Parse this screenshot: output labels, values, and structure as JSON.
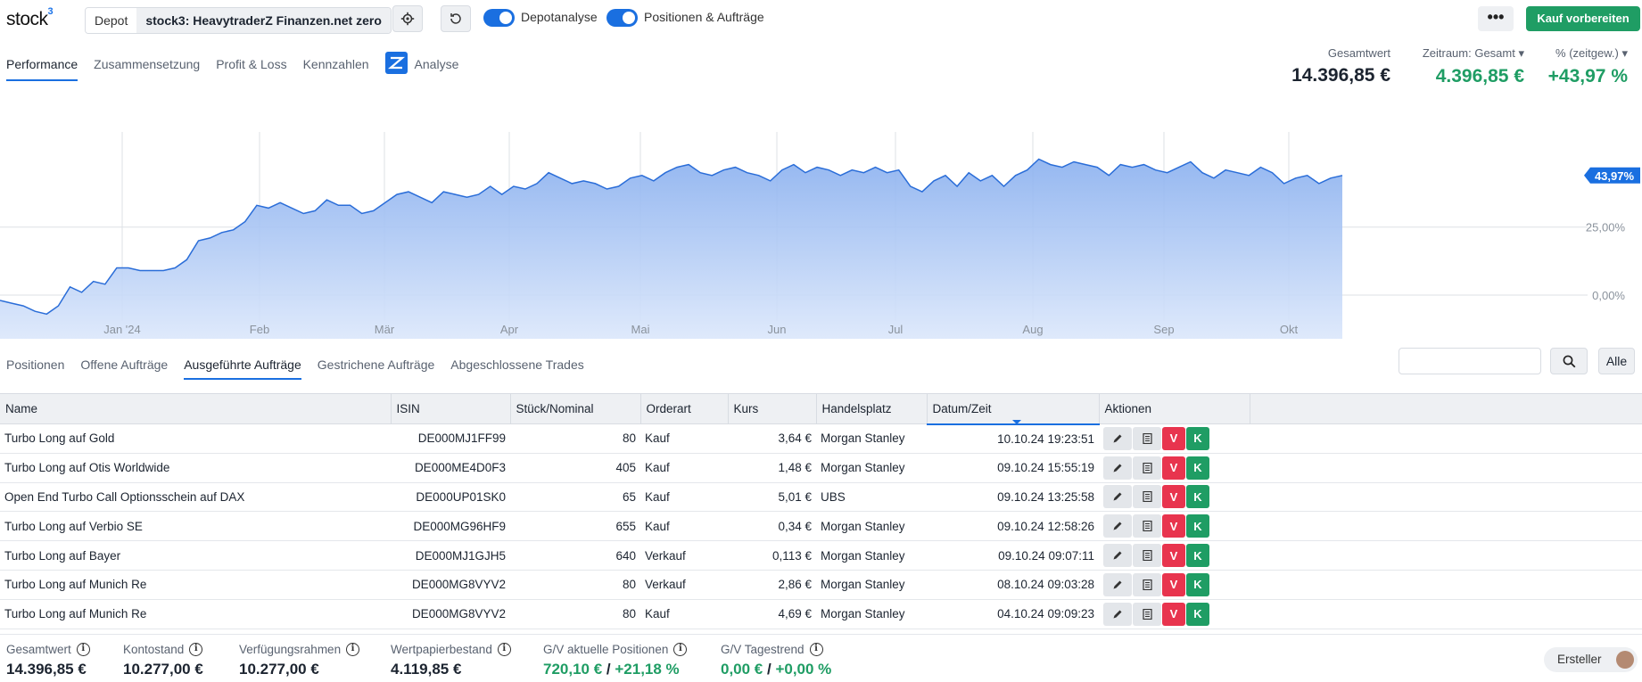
{
  "header": {
    "logo": "stock",
    "logo_sup": "3",
    "depot_label": "Depot",
    "depot_name": "stock3: HeavytraderZ Finanzen.net zero",
    "toggle1_label": "Depotanalyse",
    "toggle2_label": "Positionen & Aufträge",
    "more_label": "•••",
    "buy_label": "Kauf vorbereiten"
  },
  "tabs": [
    "Performance",
    "Zusammensetzung",
    "Profit & Loss",
    "Kennzahlen",
    "Analyse"
  ],
  "summary": {
    "gesamtwert_label": "Gesamtwert",
    "gesamtwert": "14.396,85 €",
    "zeitraum_label": "Zeitraum: Gesamt ▾",
    "zeitraum_value": "4.396,85 €",
    "pct_label": "% (zeitgew.) ▾",
    "pct_value": "+43,97 %"
  },
  "chart_data": {
    "type": "area",
    "x_ticks": [
      "Jan '24",
      "Feb",
      "Mär",
      "Apr",
      "Mai",
      "Jun",
      "Jul",
      "Aug",
      "Sep",
      "Okt"
    ],
    "y_ticks": [
      "0,00%",
      "25,00%"
    ],
    "last_value_label": "43,97%",
    "ylim": [
      -10,
      60
    ],
    "values": [
      -2,
      -3,
      -4,
      -6,
      -7,
      -4,
      3,
      1,
      5,
      4,
      10,
      10,
      9,
      9,
      9,
      10,
      13,
      20,
      21,
      23,
      24,
      27,
      33,
      32,
      34,
      32,
      30,
      31,
      35,
      33,
      33,
      30,
      31,
      34,
      37,
      38,
      36,
      34,
      38,
      37,
      36,
      37,
      40,
      37,
      40,
      39,
      41,
      45,
      43,
      41,
      42,
      41,
      39,
      40,
      43,
      44,
      42,
      45,
      47,
      48,
      45,
      44,
      46,
      47,
      45,
      44,
      42,
      46,
      48,
      45,
      47,
      46,
      44,
      46,
      45,
      47,
      45,
      46,
      40,
      38,
      42,
      44,
      40,
      45,
      42,
      44,
      40,
      44,
      46,
      50,
      48,
      47,
      49,
      48,
      47,
      44,
      48,
      47,
      48,
      46,
      45,
      47,
      49,
      45,
      43,
      46,
      45,
      44,
      47,
      45,
      41,
      43,
      44,
      41,
      43,
      44
    ],
    "grid": true
  },
  "subtabs": [
    "Positionen",
    "Offene Aufträge",
    "Ausgeführte Aufträge",
    "Gestrichene Aufträge",
    "Abgeschlossene Trades"
  ],
  "alle_label": "Alle",
  "table": {
    "headers": [
      "Name",
      "ISIN",
      "Stück/Nominal",
      "Orderart",
      "Kurs",
      "Handelsplatz",
      "Datum/Zeit",
      "Aktionen"
    ],
    "rows": [
      [
        "Turbo Long auf Gold",
        "DE000MJ1FF99",
        "80",
        "Kauf",
        "3,64 €",
        "Morgan Stanley",
        "10.10.24 19:23:51"
      ],
      [
        "Turbo Long auf Otis Worldwide",
        "DE000ME4D0F3",
        "405",
        "Kauf",
        "1,48 €",
        "Morgan Stanley",
        "09.10.24 15:55:19"
      ],
      [
        "Open End Turbo Call Optionsschein auf DAX",
        "DE000UP01SK0",
        "65",
        "Kauf",
        "5,01 €",
        "UBS",
        "09.10.24 13:25:58"
      ],
      [
        "Turbo Long auf Verbio SE",
        "DE000MG96HF9",
        "655",
        "Kauf",
        "0,34 €",
        "Morgan Stanley",
        "09.10.24 12:58:26"
      ],
      [
        "Turbo Long auf Bayer",
        "DE000MJ1GJH5",
        "640",
        "Verkauf",
        "0,113 €",
        "Morgan Stanley",
        "09.10.24 09:07:11"
      ],
      [
        "Turbo Long auf Munich Re",
        "DE000MG8VYV2",
        "80",
        "Verkauf",
        "2,86 €",
        "Morgan Stanley",
        "08.10.24 09:03:28"
      ],
      [
        "Turbo Long auf Munich Re",
        "DE000MG8VYV2",
        "80",
        "Kauf",
        "4,69 €",
        "Morgan Stanley",
        "04.10.24 09:09:23"
      ]
    ],
    "action_v": "V",
    "action_k": "K"
  },
  "footer": {
    "items": [
      {
        "label": "Gesamtwert",
        "value": "14.396,85 €"
      },
      {
        "label": "Kontostand",
        "value": "10.277,00 €"
      },
      {
        "label": "Verfügungsrahmen",
        "value": "10.277,00 €"
      },
      {
        "label": "Wertpapierbestand",
        "value": "4.119,85 €"
      }
    ],
    "gv_label": "G/V aktuelle Positionen",
    "gv_abs": "720,10 €",
    "gv_sep": " / ",
    "gv_pct": "+21,18 %",
    "tag_label": "G/V Tagestrend",
    "tag_abs": "0,00 €",
    "tag_sep": " / ",
    "tag_pct": "+0,00 %",
    "creator_label": "Ersteller",
    "info_glyph": "i"
  }
}
